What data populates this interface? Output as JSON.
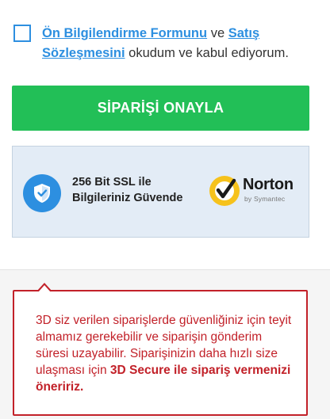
{
  "agreement": {
    "link1": "Ön Bilgilendirme Formunu",
    "conj": "ve",
    "link2": "Satış Sözleşmesini",
    "tail": "okudum ve kabul ediyorum."
  },
  "confirm_button": "SİPARİŞİ ONAYLA",
  "security": {
    "line1": "256 Bit SSL ile",
    "line2": "Bilgileriniz Güvende",
    "norton_name": "Norton",
    "norton_sub": "by Symantec"
  },
  "notice": {
    "text": "3D siz verilen siparişlerde güvenliğiniz için teyit almamız gerekebilir ve siparişin gönderim süresi uzayabilir. Siparişinizin daha hızlı size ulaşması için",
    "bold": "3D Secure ile sipariş vermenizi öneririz."
  },
  "colors": {
    "accent_blue": "#2d8fe0",
    "confirm_green": "#22bf57",
    "warning_red": "#c22129"
  }
}
